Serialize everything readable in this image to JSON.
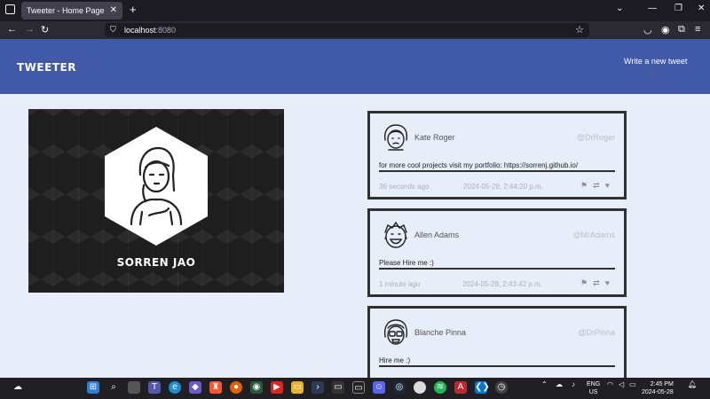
{
  "browser": {
    "tab_title": "Tweeter - Home Page",
    "tab_close": "✕",
    "new_tab": "+",
    "url_host": "localhost",
    "url_port": ":8080"
  },
  "site": {
    "logo": "TWEETER",
    "write_link": "Write a new tweet",
    "write_icon": "♡"
  },
  "profile": {
    "name": "SORREN JAO"
  },
  "tweets": [
    {
      "name": "Kate Roger",
      "handle": "@DrRoger",
      "content": "for more cool projects visit my portfolio: https://sorrenj.github.io/",
      "ago": "36 seconds ago",
      "date": "2024-05-28, 2:44:20 p.m."
    },
    {
      "name": "Allen Adams",
      "handle": "@MrAdams",
      "content": "Please Hire me :)",
      "ago": "1 minute ago",
      "date": "2024-05-28, 2:43:42 p.m."
    },
    {
      "name": "Blanche Pinna",
      "handle": "@DrPinna",
      "content": "Hire me :)",
      "ago": "",
      "date": ""
    }
  ],
  "taskbar": {
    "lang": "ENG",
    "region": "US",
    "time": "2:45 PM",
    "date": "2024-05-28"
  },
  "colors": {
    "header": "#4059a9",
    "page_bg": "#e8eef9",
    "card_border": "#303030"
  }
}
